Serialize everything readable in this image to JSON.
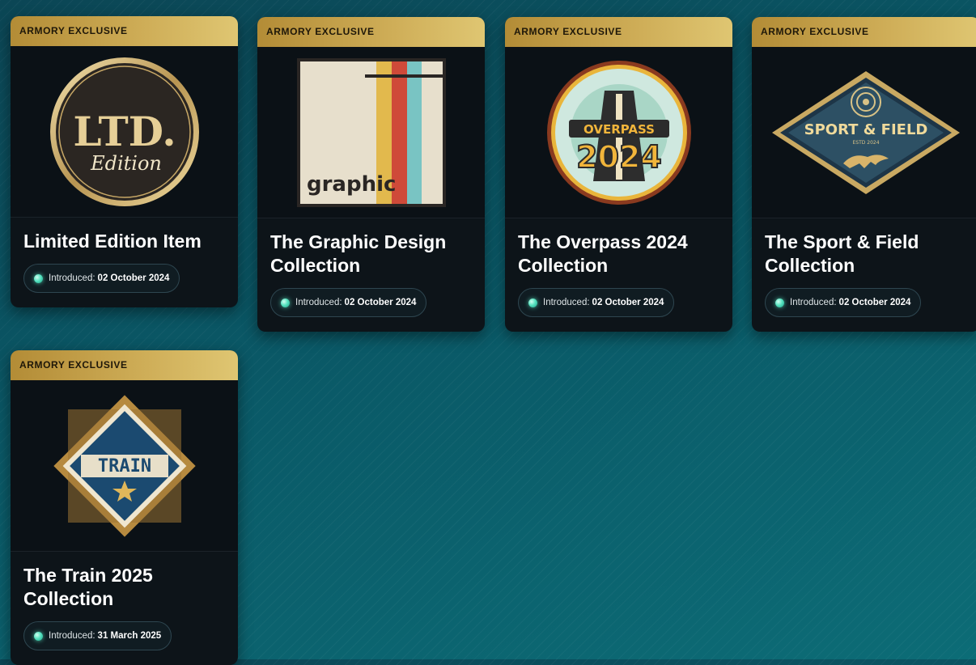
{
  "cards": [
    {
      "badge": "ARMORY EXCLUSIVE",
      "title": "Limited Edition Item",
      "intro_label": "Introduced:",
      "intro_date": "02 October 2024",
      "art": "ltd-edition-icon"
    },
    {
      "badge": "ARMORY EXCLUSIVE",
      "title": "The Graphic Design Collection",
      "intro_label": "Introduced:",
      "intro_date": "02 October 2024",
      "art": "graphic-design-icon",
      "art_text": "graphic"
    },
    {
      "badge": "ARMORY EXCLUSIVE",
      "title": "The Overpass 2024 Collection",
      "intro_label": "Introduced:",
      "intro_date": "02 October 2024",
      "art": "overpass-2024-icon",
      "art_text_top": "OVERPASS",
      "art_text_bottom": "2024"
    },
    {
      "badge": "ARMORY EXCLUSIVE",
      "title": "The Sport & Field Collection",
      "intro_label": "Introduced:",
      "intro_date": "02 October 2024",
      "art": "sport-field-icon",
      "art_text": "SPORT & FIELD",
      "art_subtext": "ESTD 2024"
    },
    {
      "badge": "ARMORY EXCLUSIVE",
      "title": "The Train 2025 Collection",
      "intro_label": "Introduced:",
      "intro_date": "31 March 2025",
      "art": "train-2025-icon",
      "art_text": "TRAIN"
    }
  ],
  "colors": {
    "badge_gold": "#cfae58",
    "card_bg": "#0d1419",
    "dot_teal": "#57e3c0",
    "page_bg": "#0a5866"
  },
  "logo_text": {
    "ltd": "LTD.",
    "edition": "Edition"
  }
}
